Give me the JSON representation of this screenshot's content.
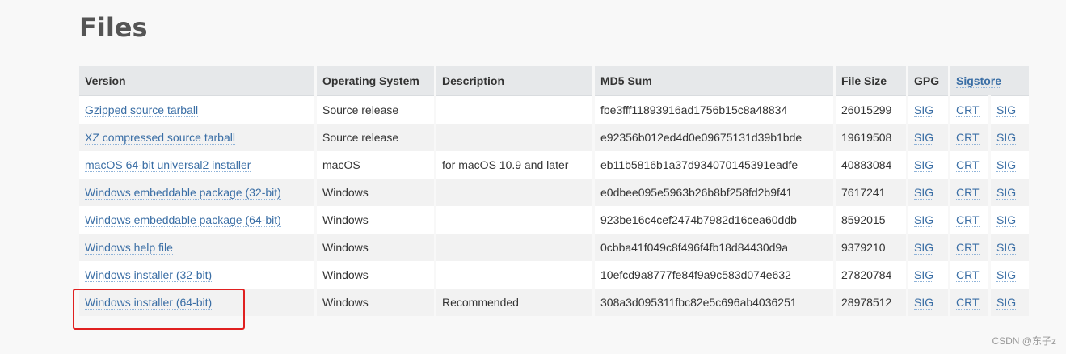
{
  "page": {
    "title": "Files",
    "watermark": "CSDN @东子z"
  },
  "colors": {
    "link": "#3a6ea5",
    "header_bg": "#e6e8ea",
    "row_even_bg": "#f2f2f2",
    "row_odd_bg": "#ffffff",
    "highlight": "#e02020"
  },
  "table": {
    "headers": {
      "version": "Version",
      "os": "Operating System",
      "description": "Description",
      "md5": "MD5 Sum",
      "file_size": "File Size",
      "gpg": "GPG",
      "sigstore": "Sigstore"
    },
    "rows": [
      {
        "version": "Gzipped source tarball",
        "os": "Source release",
        "description": "",
        "md5": "fbe3fff11893916ad1756b15c8a48834",
        "size": "26015299",
        "gpg": "SIG",
        "crt": "CRT",
        "sig": "SIG"
      },
      {
        "version": "XZ compressed source tarball",
        "os": "Source release",
        "description": "",
        "md5": "e92356b012ed4d0e09675131d39b1bde",
        "size": "19619508",
        "gpg": "SIG",
        "crt": "CRT",
        "sig": "SIG"
      },
      {
        "version": "macOS 64-bit universal2 installer",
        "os": "macOS",
        "description": "for macOS 10.9 and later",
        "md5": "eb11b5816b1a37d934070145391eadfe",
        "size": "40883084",
        "gpg": "SIG",
        "crt": "CRT",
        "sig": "SIG"
      },
      {
        "version": "Windows embeddable package (32-bit)",
        "os": "Windows",
        "description": "",
        "md5": "e0dbee095e5963b26b8bf258fd2b9f41",
        "size": "7617241",
        "gpg": "SIG",
        "crt": "CRT",
        "sig": "SIG"
      },
      {
        "version": "Windows embeddable package (64-bit)",
        "os": "Windows",
        "description": "",
        "md5": "923be16c4cef2474b7982d16cea60ddb",
        "size": "8592015",
        "gpg": "SIG",
        "crt": "CRT",
        "sig": "SIG"
      },
      {
        "version": "Windows help file",
        "os": "Windows",
        "description": "",
        "md5": "0cbba41f049c8f496f4fb18d84430d9a",
        "size": "9379210",
        "gpg": "SIG",
        "crt": "CRT",
        "sig": "SIG"
      },
      {
        "version": "Windows installer (32-bit)",
        "os": "Windows",
        "description": "",
        "md5": "10efcd9a8777fe84f9a9c583d074e632",
        "size": "27820784",
        "gpg": "SIG",
        "crt": "CRT",
        "sig": "SIG"
      },
      {
        "version": "Windows installer (64-bit)",
        "os": "Windows",
        "description": "Recommended",
        "md5": "308a3d095311fbc82e5c696ab4036251",
        "size": "28978512",
        "gpg": "SIG",
        "crt": "CRT",
        "sig": "SIG"
      }
    ]
  }
}
